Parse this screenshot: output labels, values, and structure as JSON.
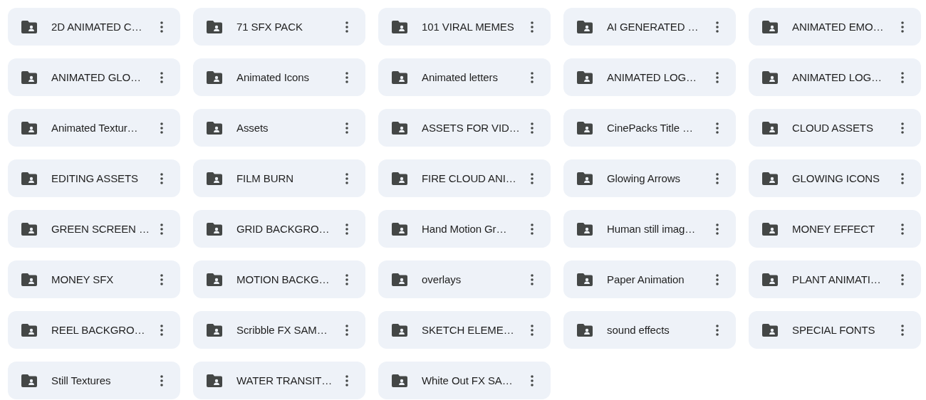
{
  "folders": [
    {
      "name": "2D ANIMATED C…"
    },
    {
      "name": "71 SFX PACK"
    },
    {
      "name": "101 VIRAL MEMES"
    },
    {
      "name": "AI GENERATED …"
    },
    {
      "name": "ANIMATED EMO…"
    },
    {
      "name": "ANIMATED GLO…"
    },
    {
      "name": "Animated Icons"
    },
    {
      "name": "Animated letters"
    },
    {
      "name": "ANIMATED LOG…"
    },
    {
      "name": "ANIMATED LOG…"
    },
    {
      "name": "Animated Textur…"
    },
    {
      "name": "Assets"
    },
    {
      "name": "ASSETS FOR VID…"
    },
    {
      "name": "CinePacks Title …"
    },
    {
      "name": "CLOUD ASSETS"
    },
    {
      "name": "EDITING ASSETS"
    },
    {
      "name": "FILM BURN"
    },
    {
      "name": "FIRE CLOUD ANI…"
    },
    {
      "name": "Glowing Arrows"
    },
    {
      "name": "GLOWING ICONS"
    },
    {
      "name": "GREEN SCREEN …"
    },
    {
      "name": "GRID BACKGRO…"
    },
    {
      "name": "Hand Motion Gr…"
    },
    {
      "name": "Human still imag…"
    },
    {
      "name": "MONEY EFFECT"
    },
    {
      "name": "MONEY SFX"
    },
    {
      "name": "MOTION BACKG…"
    },
    {
      "name": "overlays"
    },
    {
      "name": "Paper Animation"
    },
    {
      "name": "PLANT ANIMATI…"
    },
    {
      "name": "REEL BACKGRO…"
    },
    {
      "name": "Scribble FX SAM…"
    },
    {
      "name": "SKETCH ELEME…"
    },
    {
      "name": "sound effects"
    },
    {
      "name": "SPECIAL FONTS"
    },
    {
      "name": "Still Textures"
    },
    {
      "name": "WATER TRANSIT…"
    },
    {
      "name": "White Out FX SA…"
    }
  ]
}
